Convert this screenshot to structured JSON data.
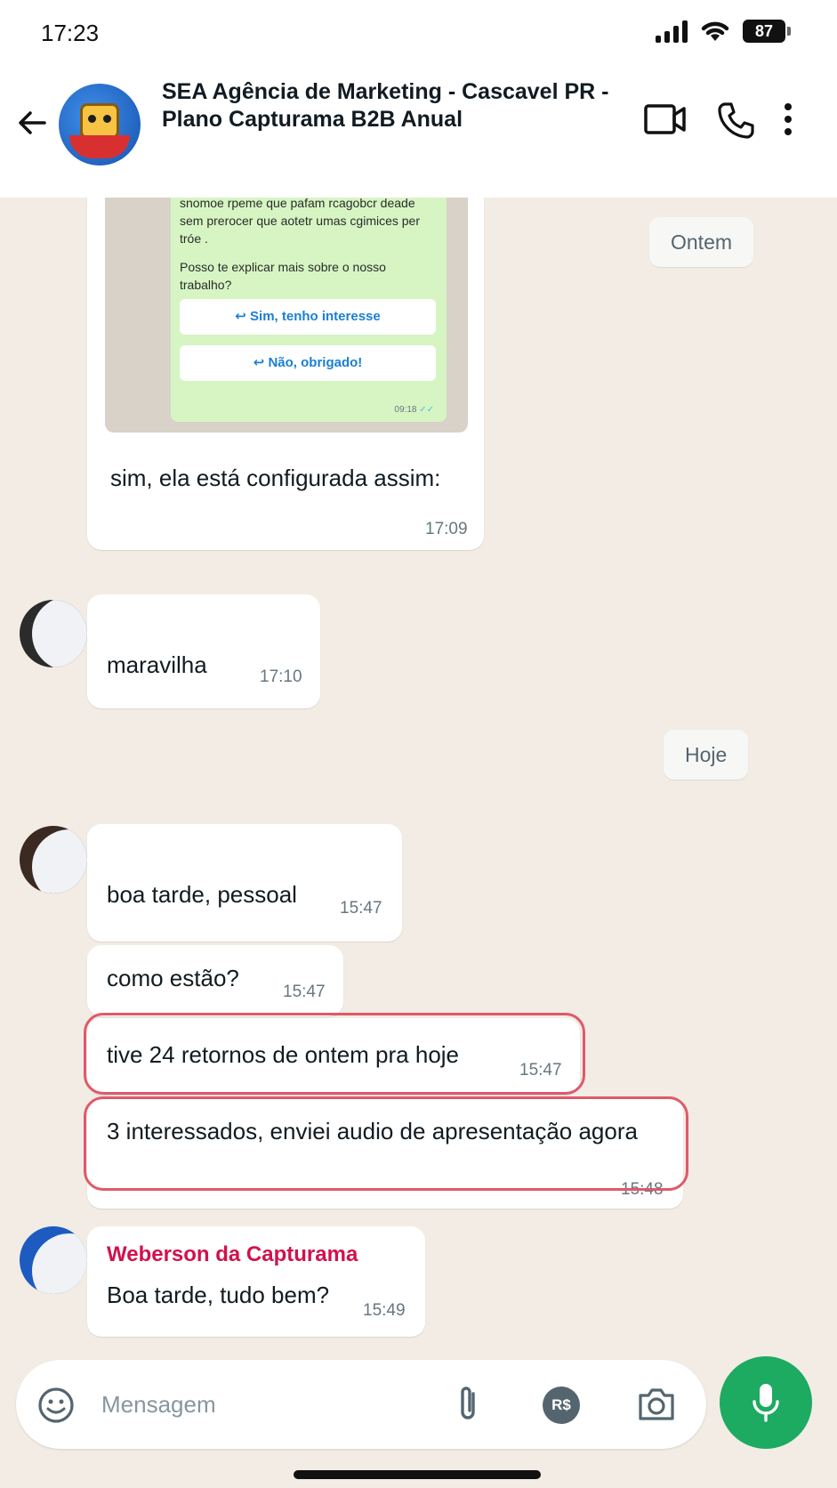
{
  "status_bar": {
    "time": "17:23",
    "battery": "87"
  },
  "header": {
    "title": "SEA Agência de Marketing - Cascavel PR - Plano Capturama B2B Anual"
  },
  "embedded_preview": {
    "text_blurred": "snomoe rpeme que pafam rcagobcr deade sem prerocer que aotetr umas cgimices per tróe .",
    "question": "Posso te explicar mais sobre o nosso trabalho?",
    "btn_yes": "Sim, tenho interesse",
    "btn_no": "Não, obrigado!",
    "time": "09:18"
  },
  "date_labels": {
    "yesterday": "Ontem",
    "today": "Hoje"
  },
  "messages": [
    {
      "text": "sim, ela está configurada assim:",
      "time": "17:09"
    },
    {
      "text": "maravilha",
      "time": "17:10"
    },
    {
      "text": "boa tarde, pessoal",
      "time": "15:47"
    },
    {
      "text": "como estão?",
      "time": "15:47"
    },
    {
      "text": "tive 24 retornos de ontem pra hoje",
      "time": "15:47"
    },
    {
      "text": "3 interessados, enviei audio de apresentação agora",
      "time": "15:48"
    },
    {
      "sender": "Weberson da Capturama",
      "text": "Boa tarde, tudo bem?",
      "time": "15:49"
    }
  ],
  "composer": {
    "placeholder": "Mensagem"
  }
}
